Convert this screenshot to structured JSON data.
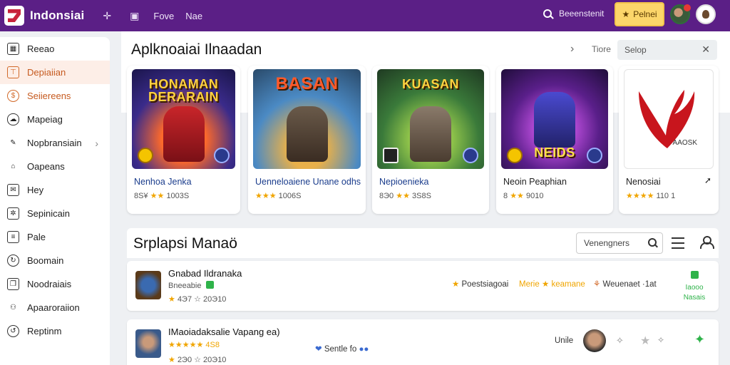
{
  "header": {
    "app_title": "Indonsiai",
    "nav_links": [
      "Fove",
      "Nae"
    ],
    "search_label": "Beeenstenit",
    "premium_label": "Pelnei"
  },
  "sidebar": {
    "items": [
      {
        "label": "Reeao",
        "icon": "grid-icon",
        "state": "normal"
      },
      {
        "label": "Depiaiian",
        "icon": "calendar-icon",
        "state": "active"
      },
      {
        "label": "Seiiereens",
        "icon": "coin-icon",
        "state": "orange"
      },
      {
        "label": "Mapeiag",
        "icon": "cloud-icon",
        "state": "normal"
      },
      {
        "label": "Nopbransiain",
        "icon": "pen-icon",
        "state": "normal"
      },
      {
        "label": "Oapeans",
        "icon": "house-icon",
        "state": "normal"
      },
      {
        "label": "Hey",
        "icon": "mail-icon",
        "state": "normal"
      },
      {
        "label": "Sepinicain",
        "icon": "puzzle-icon",
        "state": "normal"
      },
      {
        "label": "Pale",
        "icon": "document-icon",
        "state": "normal"
      },
      {
        "label": "Boomain",
        "icon": "refresh-icon",
        "state": "normal"
      },
      {
        "label": "Noodraiais",
        "icon": "bookmark-icon",
        "state": "normal"
      },
      {
        "label": "Apaaroraiion",
        "icon": "people-icon",
        "state": "normal"
      },
      {
        "label": "Reptinm",
        "icon": "refresh-icon",
        "state": "normal"
      }
    ]
  },
  "featured": {
    "title": "Aplknoaiai Ilnaadan",
    "header_label": "Tiore",
    "filter_value": "Selop",
    "cards": [
      {
        "name": "Nenhoa Jenka",
        "rating_prefix": "8S¥",
        "stars": "★★",
        "rating_suffix": "1003S",
        "thumb_text": "HONAMAN DERARAIN"
      },
      {
        "name": "Uenneloaiene Unane odhs",
        "rating_prefix": "",
        "stars": "★★★",
        "rating_suffix": "1006S",
        "thumb_text": "BASAN"
      },
      {
        "name": "Nepioenieka",
        "rating_prefix": "8Э0",
        "stars": "★★",
        "rating_suffix": "3S8S",
        "thumb_text": "KUASAN"
      },
      {
        "name": "Neoin Peaphian",
        "rating_prefix": "8",
        "stars": "★★",
        "rating_suffix": "9010",
        "thumb_text": "NEIDS"
      },
      {
        "name": "Nenosiai",
        "rating_prefix": "",
        "stars": "★★★★",
        "rating_suffix": "110 1",
        "thumb_text": "AAOSK"
      }
    ]
  },
  "list": {
    "title": "Srplapsi Manaö",
    "sort_value": "Venengners",
    "rows": [
      {
        "name": "Gnabad Ildranaka",
        "sub": "Bneeabie",
        "stars": "★",
        "meta": "4Э7 ☆ 20Э10",
        "tag_primary": "Poestsiagoai",
        "tag_accent": "Merie ★ keamane",
        "tag_secondary": "Weuenaet ·1at",
        "status": "Iaooo Nasais"
      },
      {
        "name": "IMaoiadaksalie Vapang ea)",
        "sub": "★★★★★ 4S8",
        "stars": "★",
        "meta": "2Э0 ☆ 20Э10",
        "tag_primary": "Sentle fo",
        "tag_accent": "",
        "tag_secondary": "Unile",
        "status": ""
      }
    ]
  },
  "colors": {
    "topbar": "#5b1f86",
    "accent_orange": "#c65a1f",
    "premium": "#fcd66a",
    "rating_star": "#f0a500",
    "status_green": "#2fb34a"
  }
}
